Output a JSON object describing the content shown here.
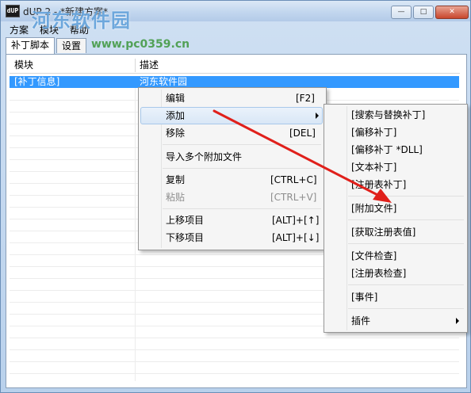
{
  "window": {
    "title": "dUP 2 - *新建方案*",
    "app_icon_text": "dUP",
    "minimize": "—",
    "maximize": "□",
    "close": "✕"
  },
  "watermark": {
    "text": "河东软件园",
    "url": "www.pc0359.cn"
  },
  "menubar": {
    "items": [
      "方案",
      "模块",
      "帮助"
    ]
  },
  "tabs": [
    "补丁脚本",
    "设置"
  ],
  "table": {
    "columns": [
      "模块",
      "描述"
    ],
    "rows": [
      {
        "module": "[补丁信息]",
        "description": "河东软件园",
        "selected": true
      }
    ]
  },
  "context_menu": {
    "items": [
      {
        "label": "编辑",
        "shortcut": "[F2]"
      },
      {
        "label": "添加",
        "submenu": true
      },
      {
        "label": "移除",
        "shortcut": "[DEL]"
      },
      {
        "label": "导入多个附加文件"
      },
      {
        "label": "复制",
        "shortcut": "[CTRL+C]"
      },
      {
        "label": "粘贴",
        "shortcut": "[CTRL+V]",
        "disabled": true
      },
      {
        "label": "上移项目",
        "shortcut": "[ALT]+[↑]"
      },
      {
        "label": "下移项目",
        "shortcut": "[ALT]+[↓]"
      }
    ]
  },
  "submenu": {
    "items": [
      "[搜索与替换补丁]",
      "[偏移补丁]",
      "[偏移补丁 *DLL]",
      "[文本补丁]",
      "[注册表补丁]",
      "[附加文件]",
      "[获取注册表值]",
      "[文件检查]",
      "[注册表检查]",
      "[事件]",
      "插件"
    ]
  },
  "colors": {
    "selection": "#3399ff",
    "annotation_arrow": "#e0201b"
  }
}
